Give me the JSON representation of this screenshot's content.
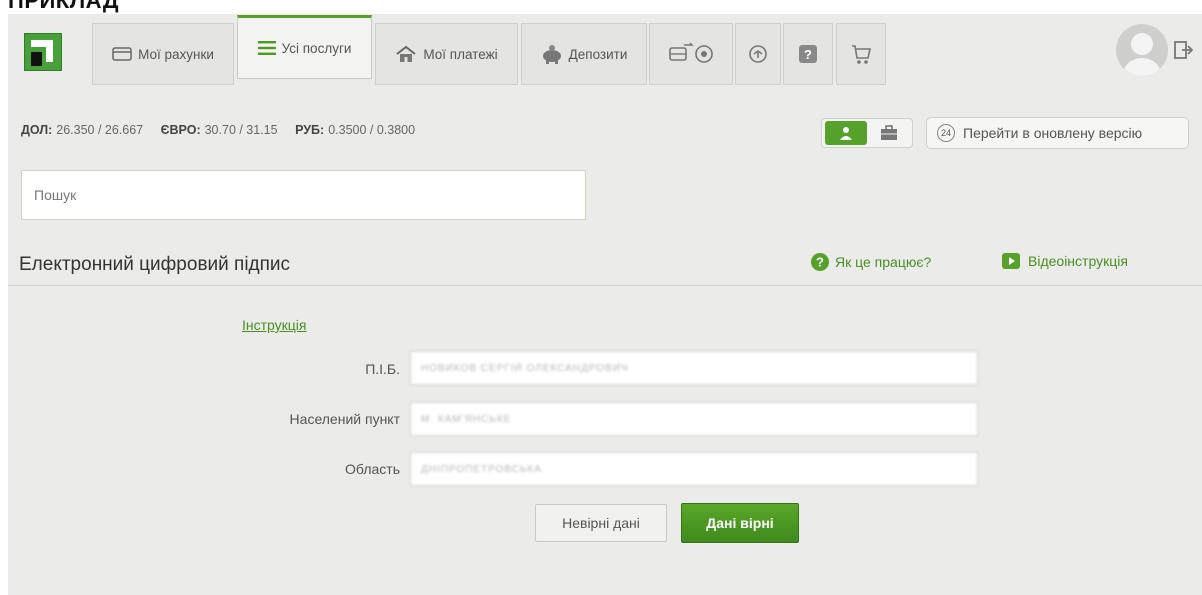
{
  "header": {
    "tabs": [
      {
        "label": "Мої рахунки",
        "icon": "card-icon"
      },
      {
        "label": "Усі послуги",
        "icon": "list-icon",
        "active": true
      },
      {
        "label": "Мої платежі",
        "icon": "house-icon"
      },
      {
        "label": "Депозити",
        "icon": "piggy-bank-icon"
      },
      {
        "label": "",
        "icon": "transport-icon"
      },
      {
        "label": "",
        "icon": "rotate-icon"
      },
      {
        "label": "",
        "icon": "help-icon"
      },
      {
        "label": "",
        "icon": "cart-icon"
      }
    ]
  },
  "rates": [
    {
      "label": "ДОЛ:",
      "value": "26.350 / 26.667"
    },
    {
      "label": "ЄВРО:",
      "value": "30.70 / 31.15"
    },
    {
      "label": "РУБ:",
      "value": "0.3500 / 0.3800"
    }
  ],
  "new_version": {
    "badge": "24",
    "label": "Перейти в оновлену версію"
  },
  "search": {
    "placeholder": "Пошук"
  },
  "section": {
    "title": "Електронний цифровий підпис",
    "help_label": "Як це працює?",
    "video_label": "Відеоінструкція"
  },
  "form": {
    "instruction_link": "Інструкція",
    "fields": [
      {
        "label": "П.І.Б.",
        "value": "НОВИКОВ СЕРГІЙ ОЛЕКСАНДРОВИЧ"
      },
      {
        "label": "Населений пункт",
        "value": "М. КАМ'ЯНСЬКЕ"
      },
      {
        "label": "Область",
        "value": "ДНІПРОПЕТРОВСЬКА"
      }
    ],
    "wrong_button": "Невірні дані",
    "correct_button": "Дані вірні"
  },
  "colors": {
    "accent": "#56a12a",
    "link": "#4a8f22",
    "background": "#ebebe9"
  }
}
